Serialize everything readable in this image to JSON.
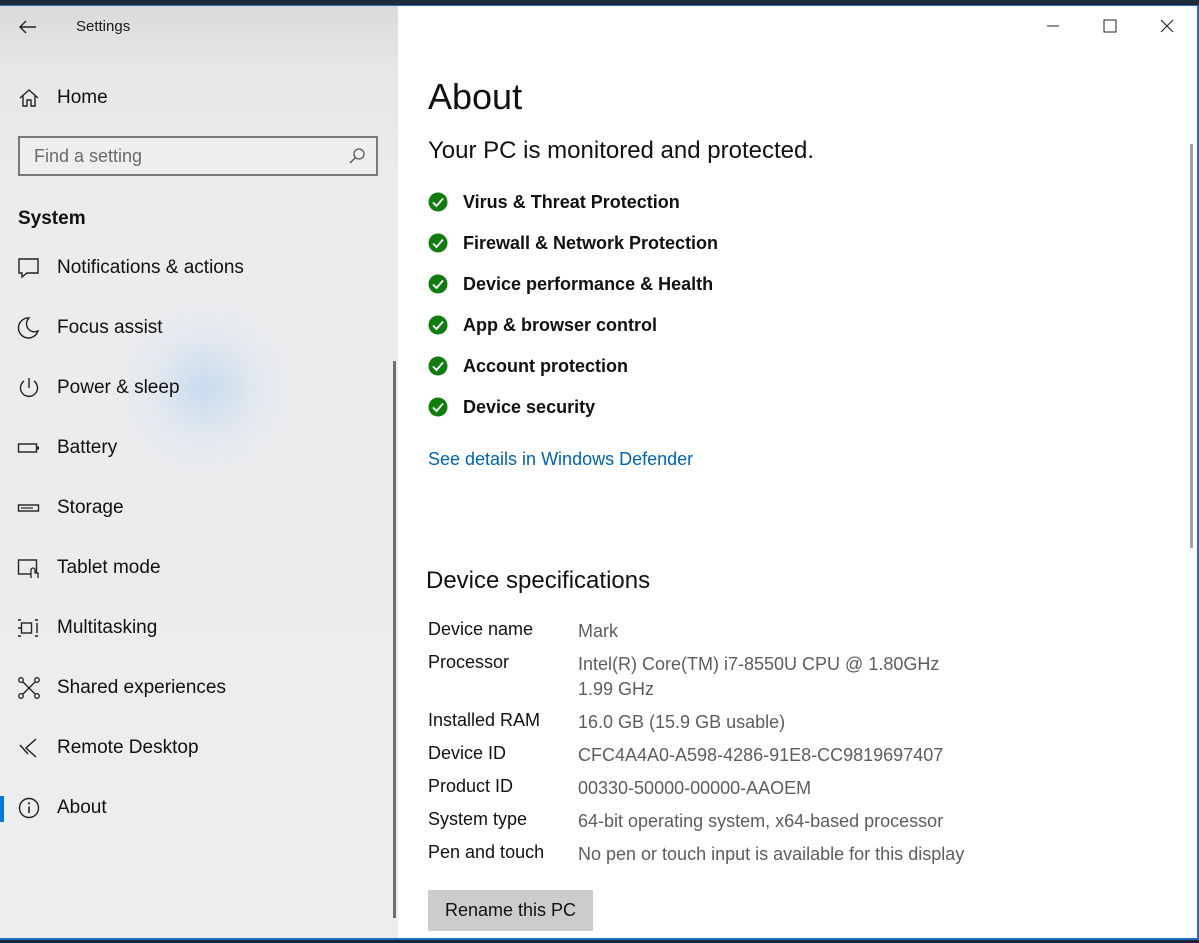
{
  "window": {
    "title": "Settings",
    "controls": [
      "minimize",
      "maximize",
      "close"
    ]
  },
  "sidebar": {
    "home_label": "Home",
    "search_placeholder": "Find a setting",
    "section_title": "System",
    "items": [
      {
        "label": "Notifications & actions",
        "icon": "notification-icon"
      },
      {
        "label": "Focus assist",
        "icon": "moon-icon"
      },
      {
        "label": "Power & sleep",
        "icon": "power-icon"
      },
      {
        "label": "Battery",
        "icon": "battery-icon"
      },
      {
        "label": "Storage",
        "icon": "storage-icon"
      },
      {
        "label": "Tablet mode",
        "icon": "tablet-icon"
      },
      {
        "label": "Multitasking",
        "icon": "multitasking-icon"
      },
      {
        "label": "Shared experiences",
        "icon": "shared-icon"
      },
      {
        "label": "Remote Desktop",
        "icon": "remote-desktop-icon"
      },
      {
        "label": "About",
        "icon": "info-icon",
        "active": true
      }
    ]
  },
  "main": {
    "title": "About",
    "protection_heading": "Your PC is monitored and protected.",
    "protections": [
      "Virus & Threat Protection",
      "Firewall & Network Protection",
      "Device performance & Health",
      "App & browser control",
      "Account protection",
      "Device security"
    ],
    "defender_link": "See details in Windows Defender",
    "specs_heading": "Device specifications",
    "specs": [
      {
        "key": "Device name",
        "value": "Mark"
      },
      {
        "key": "Processor",
        "value": "Intel(R) Core(TM) i7-8550U CPU @ 1.80GHz   1.99 GHz"
      },
      {
        "key": "Installed RAM",
        "value": "16.0 GB (15.9 GB usable)"
      },
      {
        "key": "Device ID",
        "value": "CFC4A4A0-A598-4286-91E8-CC9819697407"
      },
      {
        "key": "Product ID",
        "value": "00330-50000-00000-AAOEM"
      },
      {
        "key": "System type",
        "value": "64-bit operating system, x64-based processor"
      },
      {
        "key": "Pen and touch",
        "value": "No pen or touch input is available for this display"
      }
    ],
    "rename_button": "Rename this PC"
  },
  "colors": {
    "accent": "#0078d7",
    "link": "#0063b1",
    "check_green": "#107c10"
  }
}
